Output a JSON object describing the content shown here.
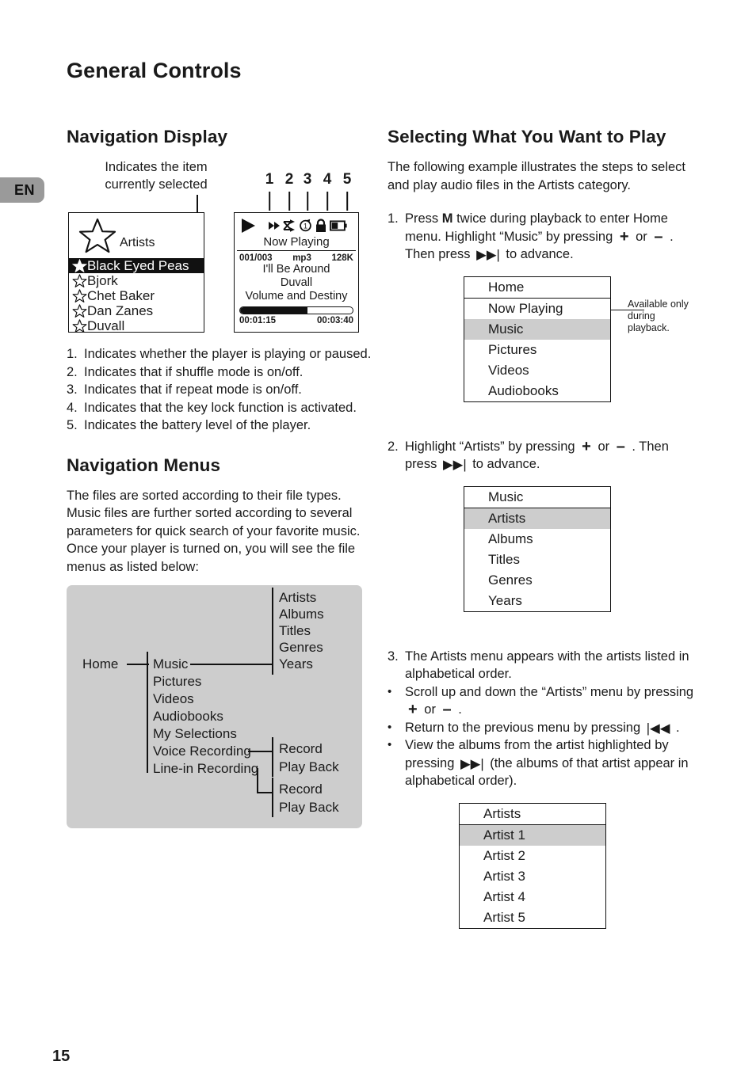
{
  "page": {
    "title": "General Controls",
    "language_badge": "EN",
    "number": "15"
  },
  "left_column": {
    "nav_display": {
      "heading": "Navigation Display",
      "callout": "Indicates the item currently selected",
      "list_screen": {
        "title": "Artists",
        "items": [
          {
            "label": "Black Eyed Peas",
            "selected": true
          },
          {
            "label": "Bjork",
            "selected": false
          },
          {
            "label": "Chet Baker",
            "selected": false
          },
          {
            "label": "Dan Zanes",
            "selected": false
          },
          {
            "label": "Duvall",
            "selected": false
          }
        ]
      },
      "now_playing_screen": {
        "tick_numbers": [
          "1",
          "2",
          "3",
          "4",
          "5"
        ],
        "status_icons": [
          "play-icon",
          "fast-forward-icon",
          "shuffle-icon",
          "repeat-one-icon",
          "key-lock-icon",
          "battery-icon"
        ],
        "title": "Now Playing",
        "track_index": "001/003",
        "format": "mp3",
        "bitrate": "128K",
        "song": "I'll Be Around",
        "artist": "Duvall",
        "album": "Volume and Destiny",
        "elapsed": "00:01:15",
        "total": "00:03:40",
        "progress_percent": 60
      },
      "legend": [
        "Indicates whether the player is playing or paused.",
        "Indicates that if shuffle mode is on/off.",
        "Indicates that if repeat mode is on/off.",
        "Indicates that the key lock function is activated.",
        "Indicates the battery level of the player."
      ]
    },
    "nav_menus": {
      "heading": "Navigation Menus",
      "body": "The files are sorted according to their file types. Music files are further sorted according to several parameters for quick search of your favorite music. Once your player is turned on, you will see the file menus as listed below:",
      "tree": {
        "root": "Home",
        "level1": [
          "Music",
          "Pictures",
          "Videos",
          "Audiobooks",
          "My Selections",
          "Voice Recording",
          "Line-in Recording"
        ],
        "music_children": [
          "Artists",
          "Albums",
          "Titles",
          "Genres",
          "Years"
        ],
        "voice_recording_children": [
          "Record",
          "Play Back"
        ],
        "linein_recording_children": [
          "Record",
          "Play Back"
        ]
      }
    }
  },
  "right_column": {
    "heading": "Selecting What You Want to Play",
    "intro": "The following example illustrates the steps to select and play audio files in the Artists category.",
    "step1": {
      "number": "1.",
      "text_a": "Press ",
      "key_m": "M",
      "text_b": " twice during playback to enter Home menu. Highlight “Music” by pressing ",
      "plus": "+",
      "or": " or ",
      "minus": "–",
      "text_c": " . Then press ",
      "next": "▶▶|",
      "text_d": " to advance."
    },
    "home_menu": {
      "header": "Home",
      "items": [
        {
          "label": "Now Playing",
          "selected": false
        },
        {
          "label": "Music",
          "selected": true
        },
        {
          "label": "Pictures",
          "selected": false
        },
        {
          "label": "Videos",
          "selected": false
        },
        {
          "label": "Audiobooks",
          "selected": false
        }
      ],
      "annotation": "Available only during playback."
    },
    "step2": {
      "number": "2.",
      "text_a": "Highlight “Artists” by pressing ",
      "plus": "+",
      "or": " or ",
      "minus": "–",
      "text_b": " . Then press ",
      "next": "▶▶|",
      "text_c": " to advance."
    },
    "music_menu": {
      "header": "Music",
      "items": [
        {
          "label": "Artists",
          "selected": true
        },
        {
          "label": "Albums",
          "selected": false
        },
        {
          "label": "Titles",
          "selected": false
        },
        {
          "label": "Genres",
          "selected": false
        },
        {
          "label": "Years",
          "selected": false
        }
      ]
    },
    "step3": {
      "number": "3.",
      "text": "The Artists menu appears with the artists listed in alphabetical order."
    },
    "bullets": [
      {
        "marker": "•",
        "text_a": "Scroll up and down the “Artists” menu by pressing ",
        "plus": "+",
        "or": " or ",
        "minus": "–",
        "text_b": " ."
      },
      {
        "marker": "•",
        "text_a": "Return to the previous menu by pressing ",
        "prev": "|◀◀",
        "text_b": " ."
      },
      {
        "marker": "•",
        "text_a": "View the albums from the artist highlighted by pressing ",
        "next": "▶▶|",
        "text_b": " (the albums of that artist appear in alphabetical order)."
      }
    ],
    "artists_menu": {
      "header": "Artists",
      "items": [
        {
          "label": "Artist 1",
          "selected": true
        },
        {
          "label": "Artist 2",
          "selected": false
        },
        {
          "label": "Artist 3",
          "selected": false
        },
        {
          "label": "Artist 4",
          "selected": false
        },
        {
          "label": "Artist 5",
          "selected": false
        }
      ]
    }
  },
  "colors": {
    "ink": "#111111",
    "highlight_gray": "#cdcdcd",
    "badge_gray": "#9a9a9a"
  }
}
